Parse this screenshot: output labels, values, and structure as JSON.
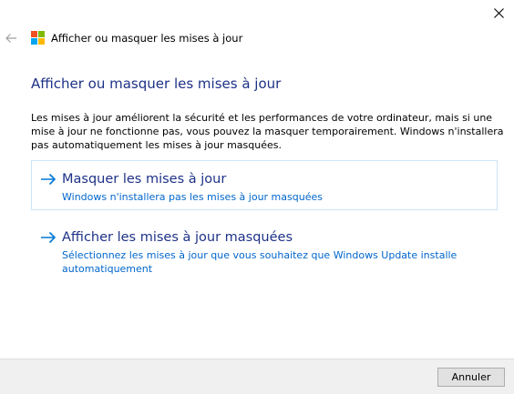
{
  "window": {
    "title": "Afficher ou masquer les mises à jour"
  },
  "main": {
    "heading": "Afficher ou masquer les mises à jour",
    "description": "Les mises à jour améliorent la sécurité et les performances de votre ordinateur, mais si une mise à jour ne fonctionne pas, vous pouvez la masquer temporairement. Windows n'installera pas automatiquement les mises à jour masquées."
  },
  "options": [
    {
      "title": "Masquer les mises à jour",
      "subtitle": "Windows n'installera pas les mises à jour masquées"
    },
    {
      "title": "Afficher les mises à jour masquées",
      "subtitle": "Sélectionnez les mises à jour que vous souhaitez que Windows Update installe automatiquement"
    }
  ],
  "footer": {
    "cancel_label": "Annuler"
  },
  "icons": {
    "close": "close-icon",
    "back": "back-arrow-icon",
    "logo": "windows-logo-icon",
    "option_arrow": "arrow-right-icon"
  },
  "colors": {
    "heading": "#1e3287",
    "link": "#0066cc",
    "arrow": "#0078d7",
    "selected_border": "#cce4f7",
    "footer_bg": "#f0f0f0",
    "logo_red": "#f25022",
    "logo_green": "#7fba00",
    "logo_blue": "#00a4ef",
    "logo_yellow": "#ffb900"
  }
}
